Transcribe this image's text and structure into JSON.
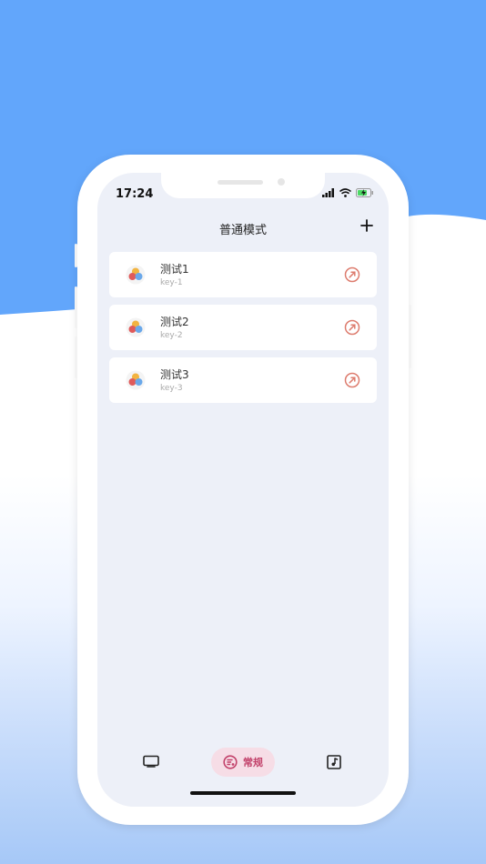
{
  "status_bar": {
    "time": "17:24"
  },
  "header": {
    "title": "普通模式"
  },
  "items": [
    {
      "title": "测试1",
      "key": "key-1"
    },
    {
      "title": "测试2",
      "key": "key-2"
    },
    {
      "title": "测试3",
      "key": "key-3"
    }
  ],
  "tabbar": {
    "regular_label": "常规"
  },
  "colors": {
    "background_blue": "#62a6fb",
    "accent_pink": "#c2416a",
    "action_icon": "#dd7c6e"
  },
  "icons": {
    "add": "plus-icon",
    "item_logo": "three-dots-logo-icon",
    "item_action": "arrow-up-right-circle-icon",
    "tab_tv": "tv-icon",
    "tab_regular": "regular-mode-icon",
    "tab_music": "music-note-icon"
  }
}
